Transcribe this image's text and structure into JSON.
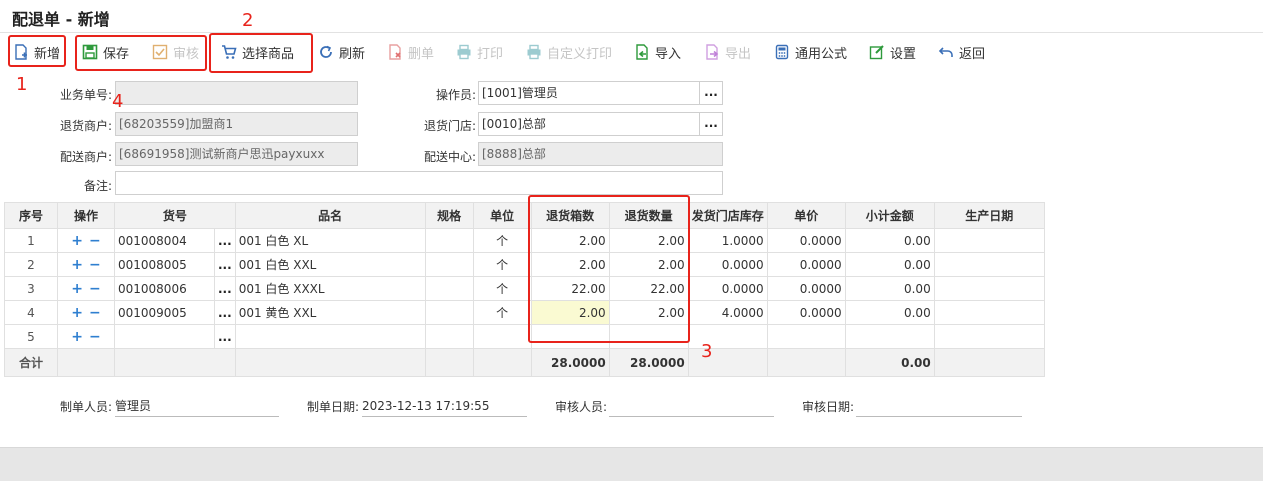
{
  "page": {
    "title": "配退单 - 新增"
  },
  "toolbar": {
    "new": "新增",
    "save": "保存",
    "audit": "审核",
    "select_goods": "选择商品",
    "refresh": "刷新",
    "delete": "删单",
    "print": "打印",
    "custom_print": "自定义打印",
    "import": "导入",
    "export": "导出",
    "formula": "通用公式",
    "settings": "设置",
    "back": "返回"
  },
  "annotations": {
    "n1": "1",
    "n2": "2",
    "n3": "3",
    "n4": "4"
  },
  "form": {
    "order_no_label": "业务单号:",
    "order_no_value": "",
    "operator_label": "操作员:",
    "operator_value": "[1001]管理员",
    "return_merchant_label": "退货商户:",
    "return_merchant_value": "[68203559]加盟商1",
    "return_store_label": "退货门店:",
    "return_store_value": "[0010]总部",
    "delivery_merchant_label": "配送商户:",
    "delivery_merchant_value": "[68691958]测试新商户思迅payxuxx",
    "delivery_center_label": "配送中心:",
    "delivery_center_value": "[8888]总部",
    "remark_label": "备注:",
    "remark_value": "",
    "dots": "..."
  },
  "grid": {
    "headers": [
      "序号",
      "操作",
      "货号",
      "品名",
      "规格",
      "单位",
      "退货箱数",
      "退货数量",
      "发货门店库存",
      "单价",
      "小计金额",
      "生产日期"
    ],
    "rows": [
      {
        "no": "1",
        "code": "001008004",
        "name": "001 白色 XL",
        "spec": "",
        "unit": "个",
        "boxes": "2.00",
        "qty": "2.00",
        "stock": "1.0000",
        "price": "0.0000",
        "subtotal": "0.00",
        "date": ""
      },
      {
        "no": "2",
        "code": "001008005",
        "name": "001 白色 XXL",
        "spec": "",
        "unit": "个",
        "boxes": "2.00",
        "qty": "2.00",
        "stock": "0.0000",
        "price": "0.0000",
        "subtotal": "0.00",
        "date": ""
      },
      {
        "no": "3",
        "code": "001008006",
        "name": "001 白色 XXXL",
        "spec": "",
        "unit": "个",
        "boxes": "22.00",
        "qty": "22.00",
        "stock": "0.0000",
        "price": "0.0000",
        "subtotal": "0.00",
        "date": ""
      },
      {
        "no": "4",
        "code": "001009005",
        "name": "001 黄色 XXL",
        "spec": "",
        "unit": "个",
        "boxes": "2.00",
        "qty": "2.00",
        "stock": "4.0000",
        "price": "0.0000",
        "subtotal": "0.00",
        "date": ""
      },
      {
        "no": "5",
        "code": "",
        "name": "",
        "spec": "",
        "unit": "",
        "boxes": "",
        "qty": "",
        "stock": "",
        "price": "",
        "subtotal": "",
        "date": ""
      }
    ],
    "total": {
      "label": "合计",
      "boxes": "28.0000",
      "qty": "28.0000",
      "subtotal": "0.00"
    },
    "plus": "+",
    "minus": "−",
    "dots": "..."
  },
  "footer": {
    "maker_label": "制单人员:",
    "maker_value": "管理员",
    "make_date_label": "制单日期:",
    "make_date_value": "2023-12-13 17:19:55",
    "auditor_label": "审核人员:",
    "auditor_value": "",
    "audit_date_label": "审核日期:",
    "audit_date_value": ""
  },
  "colors": {
    "annotation_red": "#e8231b",
    "op_blue": "#2f7fd0",
    "highlight": "#fafad2"
  }
}
